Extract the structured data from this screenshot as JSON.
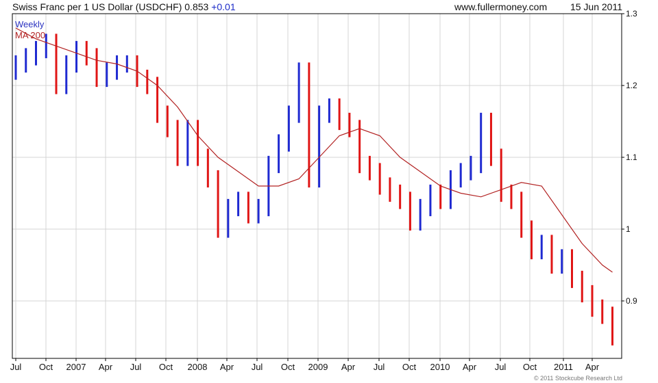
{
  "header": {
    "title": "Swiss Franc per 1 US Dollar (USDCHF)",
    "last": "0.853",
    "change": "+0.01",
    "site": "www.fullermoney.com",
    "date": "15 Jun 2011"
  },
  "copyright": "© 2011 Stockcube Research Ltd",
  "colors": {
    "up": "#1f2ad1",
    "down": "#e01515",
    "ma": "#b22222",
    "grid": "#d4d4d4"
  },
  "chart_data": {
    "type": "line",
    "title": "Swiss Franc per 1 US Dollar (USDCHF)",
    "timeframe": "Weekly",
    "ylim": [
      0.82,
      1.3
    ],
    "y_ticks": [
      0.9,
      1,
      1.1,
      1.2,
      1.3
    ],
    "y_tick_labels": [
      "0.9",
      "1",
      "1.1",
      "1.2",
      "1.3"
    ],
    "y_axis_position": "right",
    "x_tick_labels": [
      "Jul",
      "Oct",
      "2007",
      "Apr",
      "Jul",
      "Oct",
      "2008",
      "Apr",
      "Jul",
      "Oct",
      "2009",
      "Apr",
      "Jul",
      "Oct",
      "2010",
      "Apr",
      "Jul",
      "Oct",
      "2011",
      "Apr"
    ],
    "grid": true,
    "legend": "top-left",
    "series": [
      {
        "name": "Weekly",
        "style": "candlestick",
        "x": [
          "2006-07",
          "2006-08",
          "2006-09",
          "2006-10",
          "2006-11",
          "2006-12",
          "2007-01",
          "2007-02",
          "2007-03",
          "2007-04",
          "2007-05",
          "2007-06",
          "2007-07",
          "2007-08",
          "2007-09",
          "2007-10",
          "2007-11",
          "2007-12",
          "2008-01",
          "2008-02",
          "2008-03",
          "2008-04",
          "2008-05",
          "2008-06",
          "2008-07",
          "2008-08",
          "2008-09",
          "2008-10",
          "2008-11",
          "2008-12",
          "2009-01",
          "2009-02",
          "2009-03",
          "2009-04",
          "2009-05",
          "2009-06",
          "2009-07",
          "2009-08",
          "2009-09",
          "2009-10",
          "2009-11",
          "2009-12",
          "2010-01",
          "2010-02",
          "2010-03",
          "2010-04",
          "2010-05",
          "2010-06",
          "2010-07",
          "2010-08",
          "2010-09",
          "2010-10",
          "2010-11",
          "2010-12",
          "2011-01",
          "2011-02",
          "2011-03",
          "2011-04",
          "2011-05",
          "2011-06"
        ],
        "values": [
          1.23,
          1.24,
          1.25,
          1.26,
          1.2,
          1.23,
          1.25,
          1.24,
          1.21,
          1.22,
          1.23,
          1.23,
          1.21,
          1.2,
          1.16,
          1.14,
          1.1,
          1.14,
          1.1,
          1.07,
          1.0,
          1.03,
          1.04,
          1.02,
          1.03,
          1.09,
          1.12,
          1.16,
          1.22,
          1.07,
          1.16,
          1.17,
          1.15,
          1.14,
          1.09,
          1.08,
          1.06,
          1.05,
          1.04,
          1.01,
          1.03,
          1.05,
          1.04,
          1.07,
          1.08,
          1.09,
          1.15,
          1.1,
          1.05,
          1.04,
          1.0,
          0.97,
          0.98,
          0.95,
          0.96,
          0.93,
          0.91,
          0.89,
          0.88,
          0.85
        ]
      },
      {
        "name": "MA 200",
        "style": "line",
        "x": [
          "2006-07",
          "2006-09",
          "2006-11",
          "2007-01",
          "2007-03",
          "2007-05",
          "2007-07",
          "2007-09",
          "2007-11",
          "2008-01",
          "2008-03",
          "2008-05",
          "2008-07",
          "2008-09",
          "2008-11",
          "2009-01",
          "2009-03",
          "2009-05",
          "2009-07",
          "2009-09",
          "2009-11",
          "2010-01",
          "2010-03",
          "2010-05",
          "2010-07",
          "2010-09",
          "2010-11",
          "2011-01",
          "2011-03",
          "2011-05",
          "2011-06"
        ],
        "values": [
          1.28,
          1.265,
          1.255,
          1.245,
          1.235,
          1.23,
          1.22,
          1.2,
          1.17,
          1.13,
          1.1,
          1.08,
          1.06,
          1.06,
          1.07,
          1.1,
          1.13,
          1.14,
          1.13,
          1.1,
          1.08,
          1.06,
          1.05,
          1.045,
          1.055,
          1.065,
          1.06,
          1.02,
          0.98,
          0.95,
          0.94
        ]
      }
    ]
  }
}
